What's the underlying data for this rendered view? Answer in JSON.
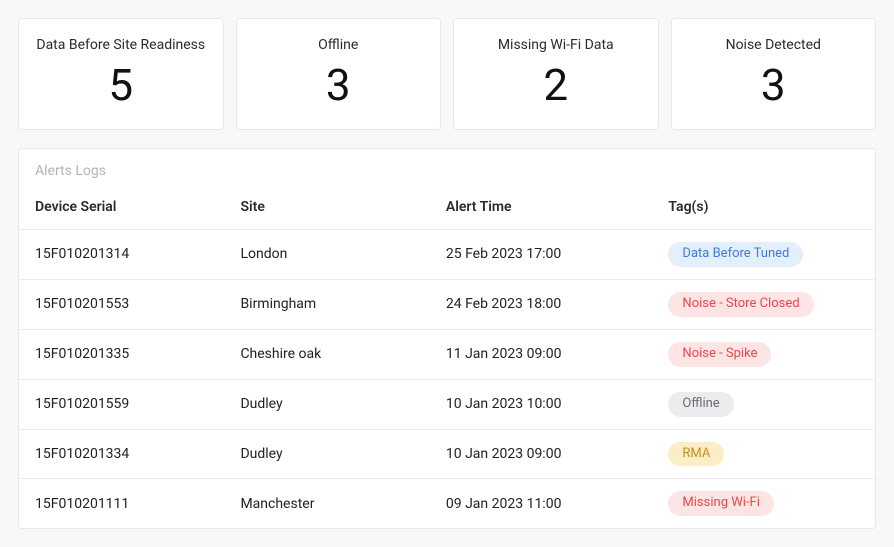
{
  "cards": [
    {
      "label": "Data Before Site Readiness",
      "value": "5"
    },
    {
      "label": "Offline",
      "value": "3"
    },
    {
      "label": "Missing Wi-Fi Data",
      "value": "2"
    },
    {
      "label": "Noise Detected",
      "value": "3"
    }
  ],
  "panel": {
    "title": "Alerts Logs",
    "columns": {
      "serial": "Device Serial",
      "site": "Site",
      "time": "Alert Time",
      "tags": "Tag(s)"
    },
    "rows": [
      {
        "serial": "15F010201314",
        "site": "London",
        "time": "25 Feb 2023 17:00",
        "tag": "Data Before Tuned",
        "tagClass": "tag-blue"
      },
      {
        "serial": "15F010201553",
        "site": "Birmingham",
        "time": "24 Feb 2023 18:00",
        "tag": "Noise - Store Closed",
        "tagClass": "tag-red"
      },
      {
        "serial": "15F010201335",
        "site": "Cheshire oak",
        "time": "11 Jan 2023 09:00",
        "tag": "Noise - Spike",
        "tagClass": "tag-red"
      },
      {
        "serial": "15F010201559",
        "site": "Dudley",
        "time": "10 Jan 2023 10:00",
        "tag": "Offline",
        "tagClass": "tag-gray"
      },
      {
        "serial": "15F010201334",
        "site": "Dudley",
        "time": "10 Jan 2023 09:00",
        "tag": "RMA",
        "tagClass": "tag-yellow"
      },
      {
        "serial": "15F010201111",
        "site": "Manchester",
        "time": "09 Jan 2023 11:00",
        "tag": "Missing Wi-Fi",
        "tagClass": "tag-red"
      }
    ]
  }
}
